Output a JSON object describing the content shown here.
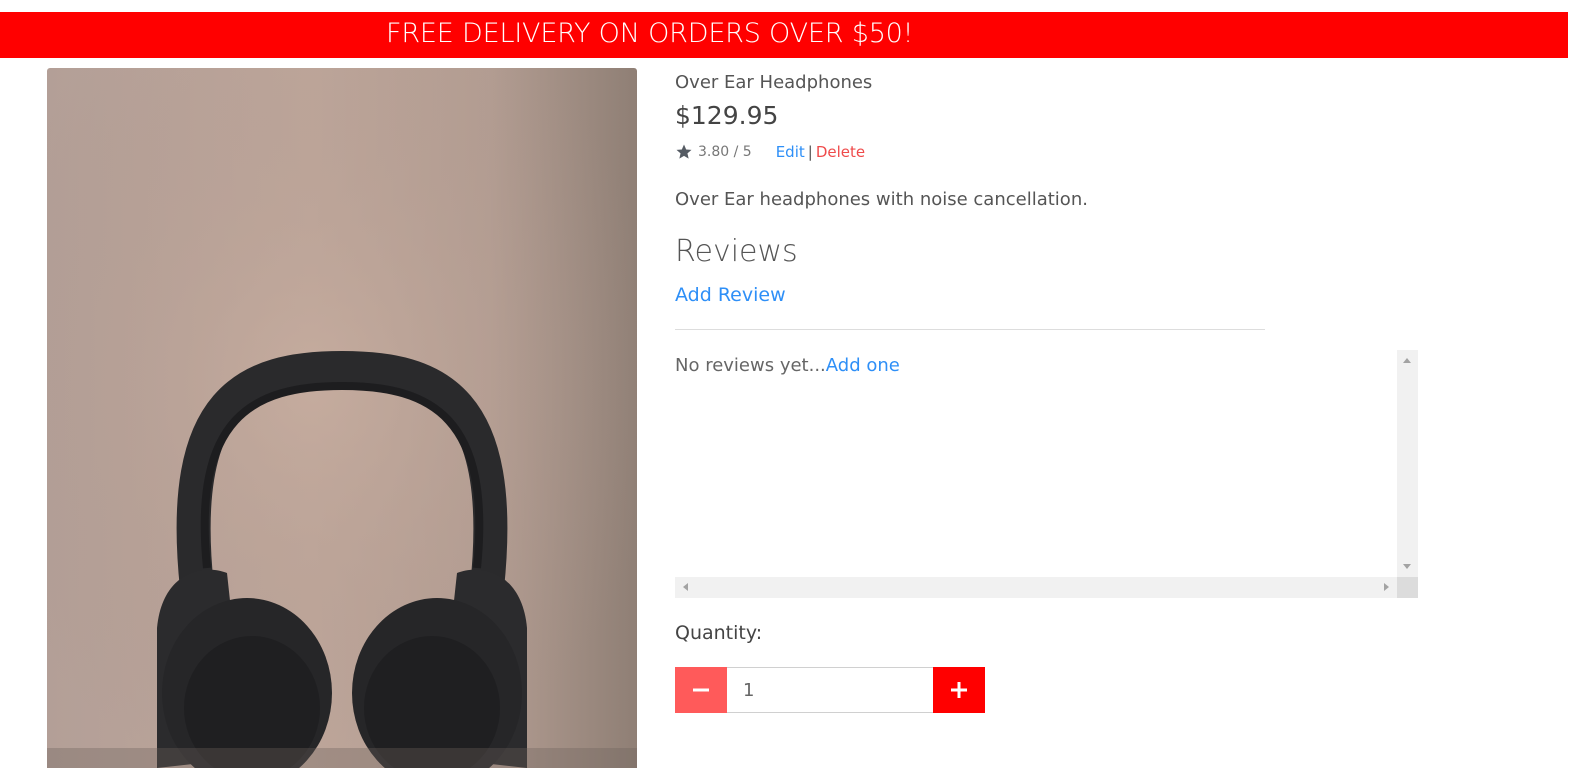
{
  "banner": {
    "text": "FREE DELIVERY ON ORDERS OVER $50!",
    "color": "#ff0000"
  },
  "product": {
    "image_alt": "Over Ear Headphones",
    "name": "Over Ear Headphones",
    "price": "$129.95",
    "rating_icon": "star-icon",
    "rating": "3.80 / 5",
    "description": "Over Ear headphones with noise cancellation."
  },
  "admin": {
    "edit_label": "Edit",
    "separator": "|",
    "delete_label": "Delete"
  },
  "reviews": {
    "heading": "Reviews",
    "add_review_label": "Add Review",
    "empty_text": "No reviews yet...",
    "add_one_label": "Add one"
  },
  "quantity": {
    "label": "Quantity:",
    "value": "1",
    "minus_icon": "minus-icon",
    "plus_icon": "plus-icon"
  },
  "colors": {
    "accent": "#ff0000",
    "link": "#2e8ff7",
    "danger": "#ef4b4b",
    "minus_button": "#ff5a5a"
  }
}
